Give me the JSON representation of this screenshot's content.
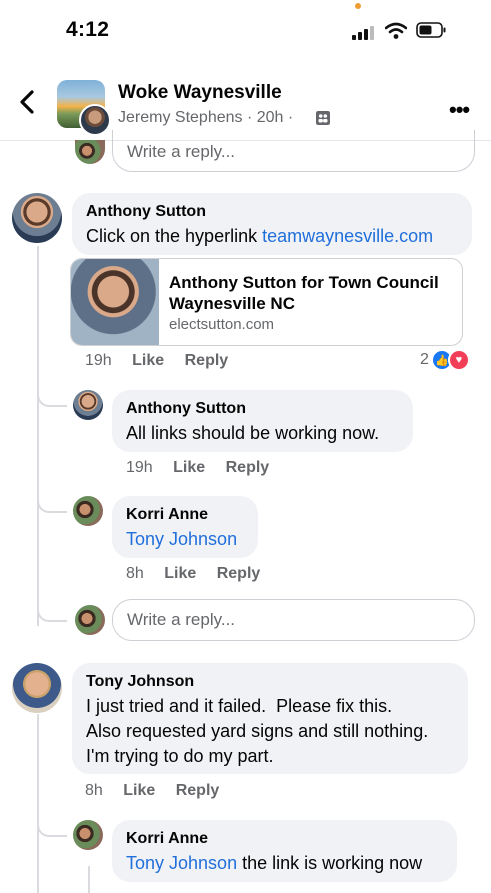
{
  "status_bar": {
    "time": "4:12"
  },
  "header": {
    "title": "Woke Waynesville",
    "subtitle": "Jeremy Stephens · 20h ·",
    "icons": {
      "back": "chevron-left-icon",
      "group": "group-icon",
      "more": "more-dots-icon"
    }
  },
  "top_reply_input": {
    "placeholder": "Write a reply..."
  },
  "comments": [
    {
      "author": "Anthony Sutton",
      "text_prefix": "Click on the hyperlink ",
      "link_text": "teamwaynesville.com",
      "link_card": {
        "title": "Anthony Sutton for Town Council Waynesville NC",
        "domain": "electsutton.com"
      },
      "time": "19h",
      "like": "Like",
      "reply": "Reply",
      "reaction_count": "2",
      "reactions": [
        "like-reaction-icon",
        "love-reaction-icon"
      ]
    },
    {
      "author": "Anthony Sutton",
      "text": "All links should be working now.",
      "time": "19h",
      "like": "Like",
      "reply": "Reply"
    },
    {
      "author": "Korri Anne",
      "link_text": "Tony Johnson",
      "time": "8h",
      "like": "Like",
      "reply": "Reply"
    },
    {
      "author": "Tony Johnson",
      "lines": [
        "I just tried and it failed.  Please fix this.",
        "Also requested yard signs and still nothing.",
        "I'm trying to do my part."
      ],
      "time": "8h",
      "like": "Like",
      "reply": "Reply"
    },
    {
      "author": "Korri Anne",
      "link_text": "Tony Johnson",
      "text_suffix": " the link is working now"
    }
  ],
  "reply_input": {
    "placeholder": "Write a reply..."
  },
  "colors": {
    "link": "#216fdb",
    "bubble": "#f0f2f5",
    "meta": "#65676b",
    "like": "#1877f2",
    "love": "#f33e58",
    "notification_dot": "#f39c33"
  }
}
